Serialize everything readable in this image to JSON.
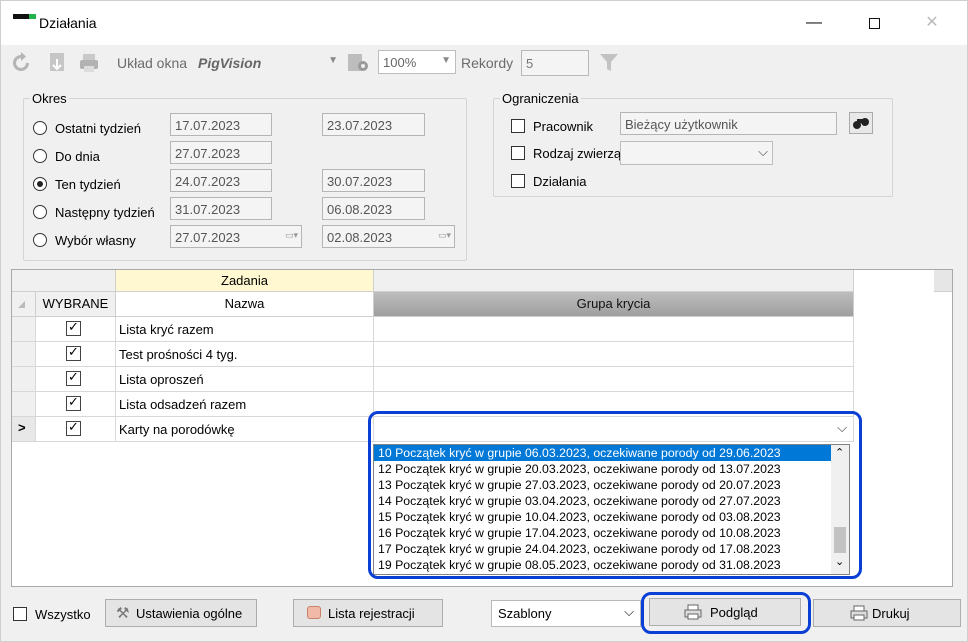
{
  "window": {
    "title": "Działania",
    "min_glyph": "—",
    "close_glyph": "✕"
  },
  "toolbar": {
    "layout_label": "Układ okna",
    "layout_value": "PigVision",
    "zoom_value": "100%",
    "records_label": "Rekordy",
    "records_value": "5",
    "icons": [
      "refresh-icon",
      "download-icon",
      "printer-icon",
      "layout-settings-icon",
      "filter-icon"
    ]
  },
  "okres": {
    "legend": "Okres",
    "options": [
      {
        "label": "Ostatni tydzień",
        "from": "17.07.2023",
        "to": "23.07.2023",
        "selected": false
      },
      {
        "label": "Do dnia",
        "from": "27.07.2023",
        "to": "",
        "selected": false
      },
      {
        "label": "Ten tydzień",
        "from": "24.07.2023",
        "to": "30.07.2023",
        "selected": true
      },
      {
        "label": "Następny tydzień",
        "from": "31.07.2023",
        "to": "06.08.2023",
        "selected": false
      },
      {
        "label": "Wybór własny",
        "from": "27.07.2023",
        "to": "02.08.2023",
        "selected": false
      }
    ]
  },
  "ograniczenia": {
    "legend": "Ograniczenia",
    "pracownik_label": "Pracownik",
    "pracownik_value": "Bieżący użytkownik",
    "rodzaj_label": "Rodzaj zwierzą",
    "dzialania_label": "Działania"
  },
  "grid": {
    "group_header": "Zadania",
    "col_wybrane": "WYBRANE",
    "col_nazwa": "Nazwa",
    "col_grupa": "Grupa krycia",
    "row_indicator": ">",
    "rows": [
      {
        "checked": true,
        "name": "Lista kryć razem",
        "grupa": ""
      },
      {
        "checked": true,
        "name": "Test prośności 4 tyg.",
        "grupa": ""
      },
      {
        "checked": true,
        "name": "Lista oproszeń",
        "grupa": ""
      },
      {
        "checked": true,
        "name": "Lista odsadzeń razem",
        "grupa": ""
      },
      {
        "checked": true,
        "name": "Karty na porodówkę",
        "grupa": ""
      }
    ]
  },
  "dropdown": {
    "items": [
      "10 Początek kryć w grupie 06.03.2023, oczekiwane porody od 29.06.2023",
      "12 Początek kryć w grupie 20.03.2023, oczekiwane porody od 13.07.2023",
      "13 Początek kryć w grupie 27.03.2023, oczekiwane porody od 20.07.2023",
      "14 Początek kryć w grupie 03.04.2023, oczekiwane porody od 27.07.2023",
      "15 Początek kryć w grupie 10.04.2023, oczekiwane porody od 03.08.2023",
      "16 Początek kryć w grupie 17.04.2023, oczekiwane porody od 10.08.2023",
      "17 Początek kryć w grupie 24.04.2023, oczekiwane porody od 17.08.2023",
      "19 Początek kryć w grupie 08.05.2023, oczekiwane porody od 31.08.2023"
    ],
    "highlighted_index": 0
  },
  "bottom": {
    "wszystko_label": "Wszystko",
    "settings_label": "Ustawienia ogólne",
    "lista_label": "Lista rejestracji",
    "szablony_label": "Szablony",
    "podglad_label": "Podgląd",
    "drukuj_label": "Drukuj"
  },
  "colors": {
    "highlight": "#0a3fd6",
    "selection": "#0078d7",
    "header_yellow": "#fff8d0"
  }
}
